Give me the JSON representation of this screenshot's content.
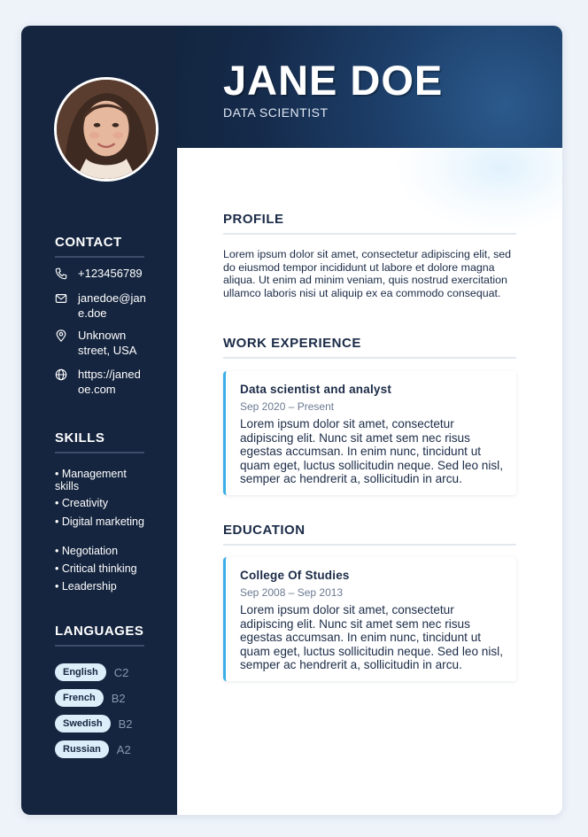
{
  "header": {
    "name": "JANE DOE",
    "role": "DATA SCIENTIST"
  },
  "contact": {
    "title": "CONTACT",
    "items": [
      {
        "icon": "phone-icon",
        "text": "+123456789"
      },
      {
        "icon": "mail-icon",
        "text": "janedoe@jane.doe"
      },
      {
        "icon": "location-pin-icon",
        "text": "Unknown street, USA"
      },
      {
        "icon": "globe-icon",
        "text": "https://janedoe.com"
      }
    ]
  },
  "skills": {
    "title": "SKILLS",
    "items": [
      "• Management skills",
      "• Creativity",
      "• Digital marketing",
      "• Negotiation",
      "• Critical thinking",
      "• Leadership"
    ]
  },
  "languages": {
    "title": "LANGUAGES",
    "items": [
      {
        "name": "English",
        "level": "C2"
      },
      {
        "name": "French",
        "level": "B2"
      },
      {
        "name": "Swedish",
        "level": "B2"
      },
      {
        "name": "Russian",
        "level": "A2"
      }
    ]
  },
  "profile": {
    "title": "PROFILE",
    "text": "Lorem ipsum dolor sit amet, consectetur adipiscing elit, sed do eiusmod tempor incididunt ut labore et dolore magna aliqua. Ut enim ad minim veniam, quis nostrud exercitation ullamco laboris nisi ut aliquip ex ea commodo consequat."
  },
  "work": {
    "title": "WORK EXPERIENCE",
    "entries": [
      {
        "title": "Data scientist and analyst",
        "date": "Sep 2020 – Present",
        "text": "Lorem ipsum dolor sit amet, consectetur adipiscing elit. Nunc sit amet sem nec risus egestas accumsan. In enim nunc, tincidunt ut quam eget, luctus sollicitudin neque. Sed leo nisl, semper ac hendrerit a, sollicitudin in arcu."
      }
    ]
  },
  "education": {
    "title": "EDUCATION",
    "entries": [
      {
        "title": "College Of Studies",
        "date": "Sep 2008 – Sep 2013",
        "text": "Lorem ipsum dolor sit amet, consectetur adipiscing elit. Nunc sit amet sem nec risus egestas accumsan. In enim nunc, tincidunt ut quam eget, luctus sollicitudin neque. Sed leo nisl, semper ac hendrerit a, sollicitudin in arcu."
      }
    ]
  },
  "colors": {
    "sidebar": "#15253f",
    "accent": "#3aaee6",
    "pill": "#dbeefa",
    "text": "#1b2b47"
  }
}
